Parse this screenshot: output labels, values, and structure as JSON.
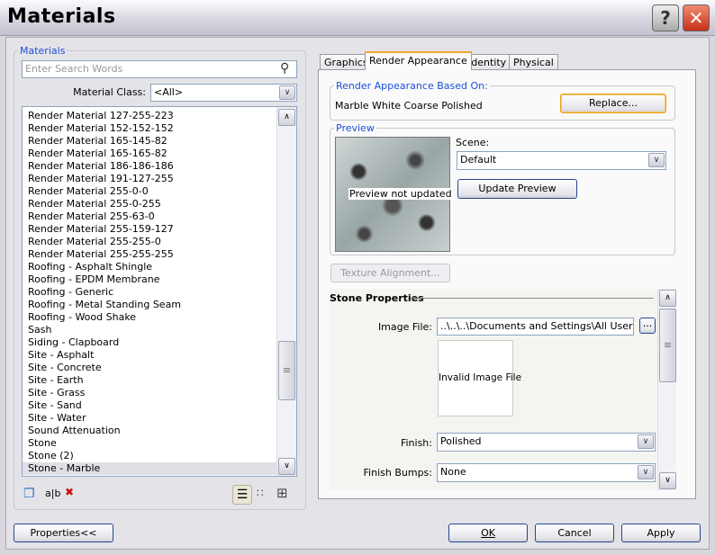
{
  "window": {
    "title": "Materials",
    "help": "?",
    "close": "✕"
  },
  "left": {
    "group_label": "Materials",
    "search_placeholder": "Enter Search Words",
    "class_label": "Material Class:",
    "class_value": "<All>",
    "items": [
      "Render Material 127-255-223",
      "Render Material 152-152-152",
      "Render Material 165-145-82",
      "Render Material 165-165-82",
      "Render Material 186-186-186",
      "Render Material 191-127-255",
      "Render Material 255-0-0",
      "Render Material 255-0-255",
      "Render Material 255-63-0",
      "Render Material 255-159-127",
      "Render Material 255-255-0",
      "Render Material 255-255-255",
      "Roofing - Asphalt Shingle",
      "Roofing - EPDM Membrane",
      "Roofing - Generic",
      "Roofing - Metal Standing Seam",
      "Roofing - Wood Shake",
      "Sash",
      "Siding - Clapboard",
      "Site - Asphalt",
      "Site - Concrete",
      "Site - Earth",
      "Site - Grass",
      "Site - Sand",
      "Site - Water",
      "Sound Attenuation",
      "Stone",
      "Stone (2)",
      "Stone - Marble"
    ],
    "selected": "Stone - Marble",
    "rename_glyph": "a|b"
  },
  "tabs": [
    "Graphics",
    "Render Appearance",
    "Identity",
    "Physical"
  ],
  "active_tab": "Render Appearance",
  "render": {
    "based_on_label": "Render Appearance Based On:",
    "based_on_value": "Marble White Coarse Polished",
    "replace": "Replace...",
    "preview_label": "Preview",
    "preview_note": "Preview not updated",
    "scene_label": "Scene:",
    "scene_value": "Default",
    "update_preview": "Update Preview",
    "texture_alignment": "Texture Alignment...",
    "section": "Stone Properties",
    "image_file_label": "Image File:",
    "image_file_value": "..\\..\\..\\Documents and Settings\\All Users\\A",
    "browse": "...",
    "invalid_image": "Invalid Image File",
    "finish_label": "Finish:",
    "finish_value": "Polished",
    "finish_bumps_label": "Finish Bumps:",
    "finish_bumps_value": "None"
  },
  "footer": {
    "properties": "Properties<<",
    "ok": "OK",
    "cancel": "Cancel",
    "apply": "Apply"
  }
}
